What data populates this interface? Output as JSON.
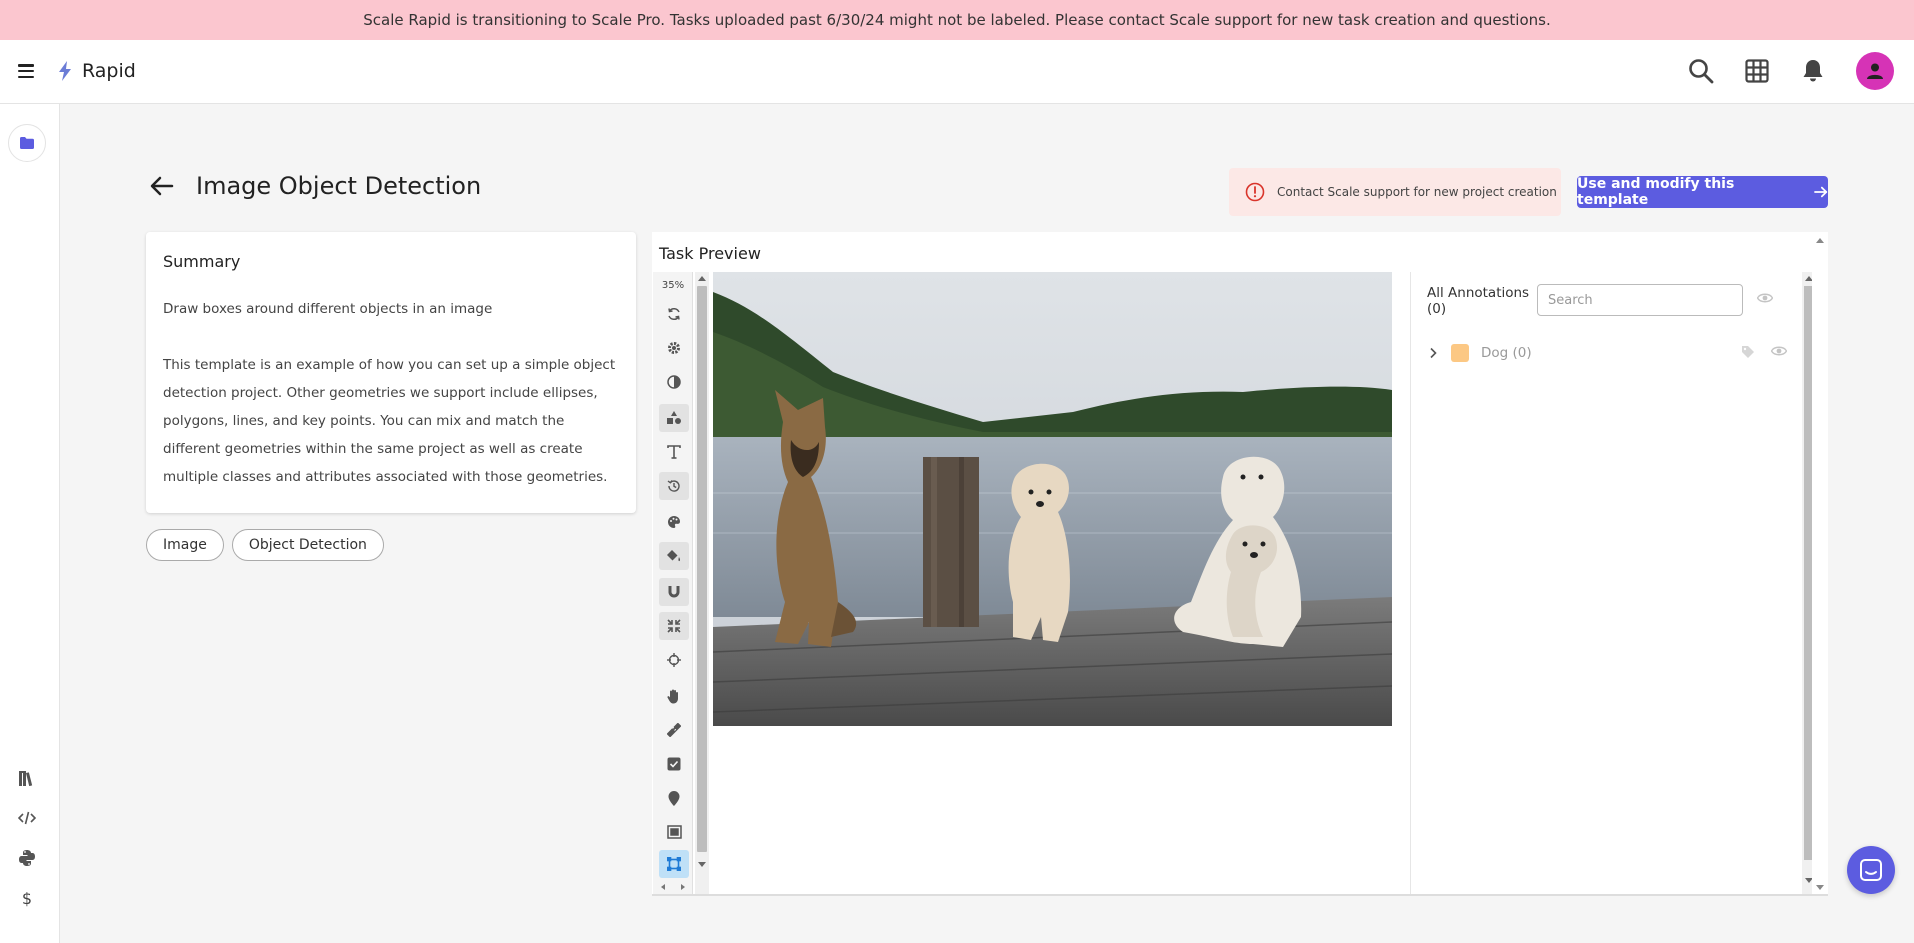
{
  "banner": {
    "text": "Scale Rapid is transitioning to Scale Pro. Tasks uploaded past 6/30/24 might not be labeled. Please contact Scale support for new task creation and questions."
  },
  "app": {
    "name": "Rapid",
    "brand_color": "#5c5ce0",
    "avatar_color": "#d633b6"
  },
  "topbar": {
    "icons": [
      "search-icon",
      "apps-grid-icon",
      "bell-icon",
      "user-avatar"
    ]
  },
  "sidebar": {
    "active_icon": "folder-icon",
    "bottom_icons": [
      "library-icon",
      "code-icon",
      "python-icon",
      "dollar-icon"
    ]
  },
  "page": {
    "title": "Image Object Detection"
  },
  "alert": {
    "text": "Contact Scale support for new project creation",
    "color": "#fce8e6"
  },
  "use_button": {
    "label": "Use and modify this template"
  },
  "summary": {
    "title": "Summary",
    "line1": "Draw boxes around different objects in an image",
    "body": "This template is an example of how you can set up a simple object detection project. Other geometries we support include ellipses, polygons, lines, and key points. You can mix and match the different geometries within the same project as well as create multiple classes and attributes associated with those geometries."
  },
  "tags": [
    "Image",
    "Object Detection"
  ],
  "preview": {
    "title": "Task Preview",
    "zoom": "35%",
    "tools": [
      "rotate-icon",
      "settings-icon",
      "contrast-icon",
      "shapes-icon",
      "text-icon",
      "history-icon",
      "palette-icon",
      "fill-icon",
      "magnet-icon",
      "compress-icon",
      "crosshair-icon",
      "hand-icon",
      "ruler-icon",
      "checkbox-icon",
      "pin-icon",
      "image-box-icon",
      "box-tool-icon"
    ],
    "selected_tool": "box-tool-icon"
  },
  "annotations": {
    "title": "All Annotations (0)",
    "search_placeholder": "Search",
    "classes": [
      {
        "label": "Dog (0)",
        "color": "#fcc884"
      }
    ]
  }
}
